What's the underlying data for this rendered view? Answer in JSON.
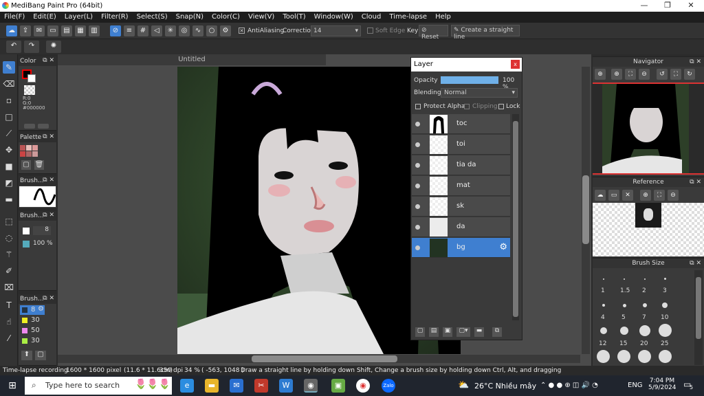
{
  "window": {
    "title": "MediBang Paint Pro (64bit)",
    "min": "—",
    "max": "❐",
    "close": "✕"
  },
  "menu": [
    "File(F)",
    "Edit(E)",
    "Layer(L)",
    "Filter(R)",
    "Select(S)",
    "Snap(N)",
    "Color(C)",
    "View(V)",
    "Tool(T)",
    "Window(W)",
    "Cloud",
    "Time-lapse",
    "Help"
  ],
  "toolbar": {
    "antialiasing": "AntiAliasing",
    "correction_label": "Correction",
    "correction_value": "14",
    "softedge": "Soft Edge",
    "key": "Key",
    "reset": "Reset",
    "straight_line": "Create a straight line"
  },
  "document": {
    "tab": "Untitled"
  },
  "color_panel": {
    "title": "Color",
    "r": "R:0",
    "g": "G:0",
    "b": "B:0",
    "hex": "#000000"
  },
  "palette_panel": {
    "title": "Palette"
  },
  "brush_panel1": {
    "title": "Brush..."
  },
  "brush_panel2": {
    "title": "Brush...",
    "size": "8",
    "opacity": "100 %"
  },
  "brush_panel3": {
    "title": "Brush...",
    "items": [
      "8",
      "30",
      "50",
      "30"
    ]
  },
  "layer_panel": {
    "title": "Layer",
    "opacity_label": "Opacity",
    "opacity_value": "100 %",
    "blending_label": "Blending",
    "blending_value": "Normal",
    "protect_alpha": "Protect Alpha",
    "clipping": "Clipping",
    "lock": "Lock",
    "layers": [
      "toc",
      "toi",
      "tia da",
      "mat",
      "sk",
      "da",
      "bg"
    ]
  },
  "navigator": {
    "title": "Navigator"
  },
  "reference": {
    "title": "Reference"
  },
  "brush_size": {
    "title": "Brush Size",
    "sizes": [
      "1",
      "1.5",
      "2",
      "3",
      "4",
      "5",
      "7",
      "10",
      "12",
      "15",
      "20",
      "25"
    ]
  },
  "status": {
    "recording": "Time-lapse recording",
    "size": "1600 * 1600 pixel",
    "cm": "(11.6 * 11.6cm)",
    "dpi": "350 dpi",
    "zoom": "34 %",
    "coords": "( -563, 1048 )",
    "hint": "Draw a straight line by holding down Shift, Change a brush size by holding down Ctrl, Alt, and dragging"
  },
  "taskbar": {
    "search": "Type here to search",
    "weather": "26°C  Nhiều mây",
    "lang": "ENG",
    "time": "7:04 PM",
    "date": "5/9/2024",
    "notif": "5"
  },
  "colors": {
    "accent": "#3f7fd0",
    "panel": "#3a3a3a",
    "foreground": "#000000"
  }
}
